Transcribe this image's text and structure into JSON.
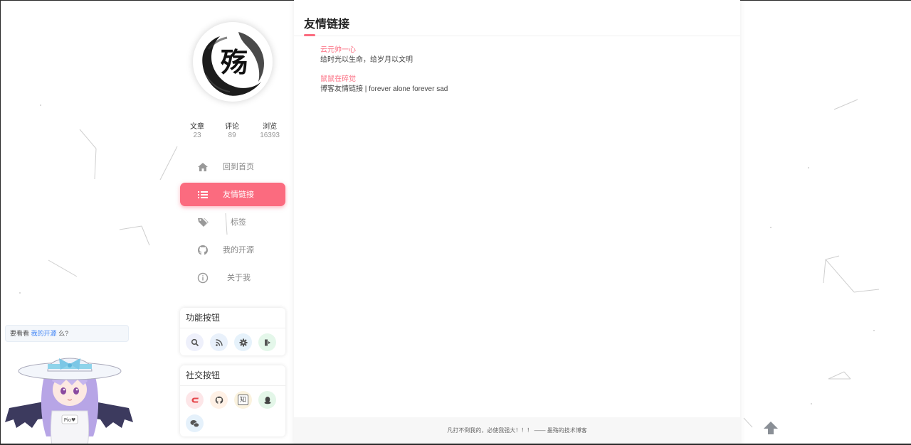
{
  "avatar": {
    "glyph": "殇"
  },
  "stats": [
    {
      "label": "文章",
      "value": "23"
    },
    {
      "label": "评论",
      "value": "89"
    },
    {
      "label": "浏览",
      "value": "16393"
    }
  ],
  "menu": [
    {
      "label": "回到首页",
      "icon": "home-icon"
    },
    {
      "label": "友情链接",
      "icon": "list-icon",
      "active": true
    },
    {
      "label": "标签",
      "icon": "tags-icon"
    },
    {
      "label": "我的开源",
      "icon": "github-icon"
    },
    {
      "label": "关于我",
      "icon": "info-icon"
    }
  ],
  "function_card": {
    "title": "功能按钮",
    "buttons": [
      "search-icon",
      "rss-icon",
      "gear-icon",
      "logout-icon"
    ]
  },
  "social_card": {
    "title": "社交按钮",
    "buttons": [
      "csdn-icon",
      "github-icon",
      "zhihu-icon",
      "qq-icon",
      "wechat-icon"
    ],
    "zhihu_glyph": "知"
  },
  "main": {
    "title": "友情链接",
    "friends": [
      {
        "name": "云元帅一心",
        "desc": "给时光以生命，给岁月以文明"
      },
      {
        "name": "鼠鼠在碎觉",
        "desc": "博客友情链接 | forever alone forever sad"
      }
    ],
    "footer": "凡打不倒我的，必使我强大！！！ —— 墨殇的技术博客"
  },
  "bubble": {
    "prefix": "要看看",
    "link": "我的开源",
    "suffix": "么?"
  },
  "colors": {
    "accent": "#fb6b7f",
    "link": "#3b82f6"
  }
}
